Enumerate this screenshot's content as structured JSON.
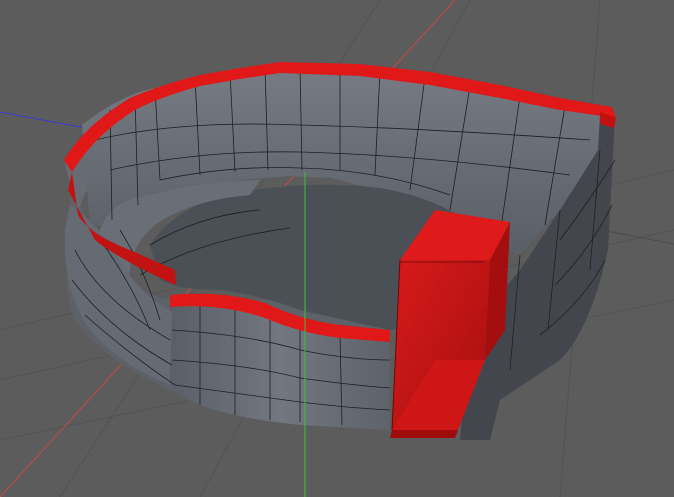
{
  "viewport": {
    "view": "perspective",
    "background_color": "#5c5c5c",
    "grid_color": "#4f4f4f"
  },
  "axes": {
    "x_axis_color": "#d04040",
    "y_axis_color": "#40c040",
    "z_axis_color": "#4040d0"
  },
  "model": {
    "shape": "open-top bowl-shaped shell with thick walls",
    "wall_color": "#6e737b",
    "wall_dark_color": "#51565d",
    "floor_color": "#4a4f56",
    "edge_color": "#1d1f22",
    "selection_color": "#e01818",
    "selected_parts": [
      "top-rim-edge-loop",
      "corner-block"
    ]
  }
}
